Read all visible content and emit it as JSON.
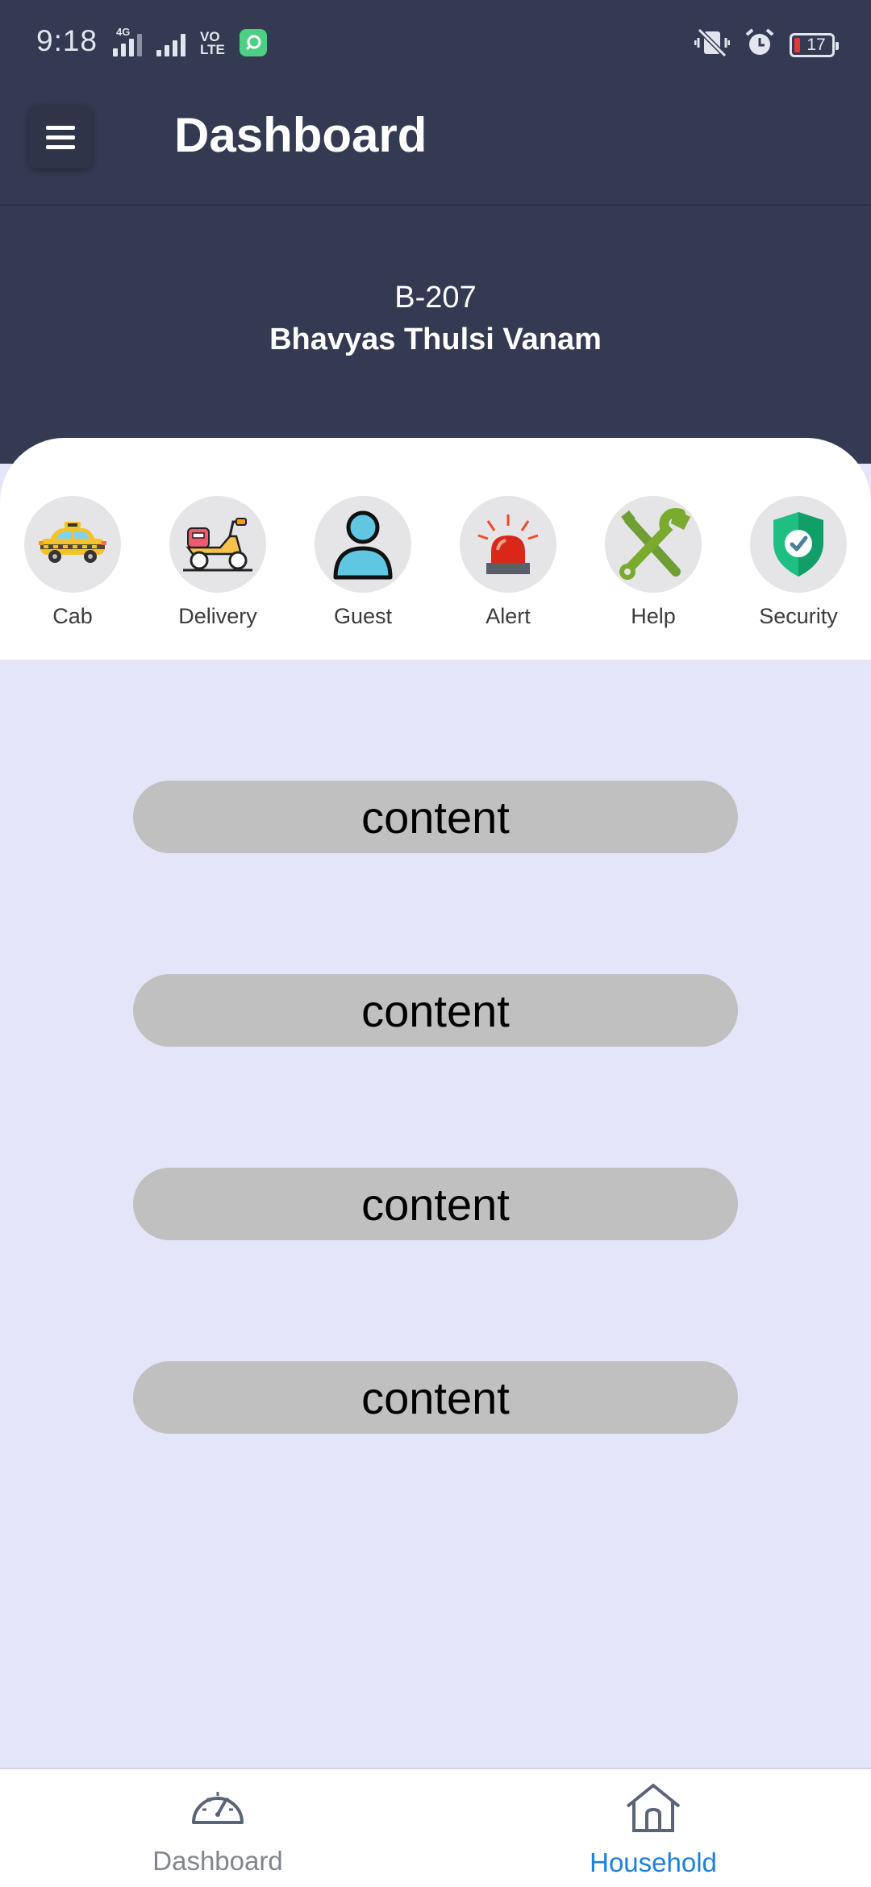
{
  "status_bar": {
    "time": "9:18",
    "network_label": "4G",
    "volte_label_top": "VO",
    "volte_label_bottom": "LTE",
    "battery_level": "17",
    "icons": [
      "signal-icon",
      "signal-icon",
      "volte-icon",
      "app-notification-icon",
      "vibrate-off-icon",
      "alarm-icon",
      "battery-icon"
    ]
  },
  "app_bar": {
    "title": "Dashboard",
    "menu_icon": "hamburger-menu-icon"
  },
  "header": {
    "unit": "B-207",
    "society": "Bhavyas Thulsi Vanam"
  },
  "quick_actions": [
    {
      "label": "Cab",
      "icon": "taxi-icon"
    },
    {
      "label": "Delivery",
      "icon": "delivery-scooter-icon"
    },
    {
      "label": "Guest",
      "icon": "person-icon"
    },
    {
      "label": "Alert",
      "icon": "siren-icon"
    },
    {
      "label": "Help",
      "icon": "tools-icon"
    },
    {
      "label": "Security",
      "icon": "shield-check-icon"
    }
  ],
  "content_items": [
    {
      "label": "content"
    },
    {
      "label": "content"
    },
    {
      "label": "content"
    },
    {
      "label": "content"
    }
  ],
  "bottom_nav": {
    "items": [
      {
        "label": "Dashboard",
        "icon": "speedometer-icon",
        "active": false
      },
      {
        "label": "Household",
        "icon": "home-icon",
        "active": true
      }
    ]
  },
  "colors": {
    "header_bg": "#343a52",
    "body_bg": "#e5e5f9",
    "pill_bg": "#c0c0c0",
    "active_nav": "#1d7fe0",
    "inactive_nav": "#808590"
  }
}
